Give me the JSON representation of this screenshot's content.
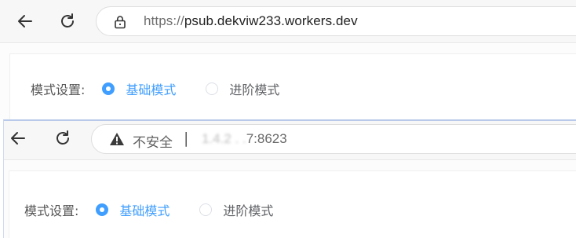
{
  "top_browser": {
    "url_scheme": "https://",
    "url_host": "psub.dekviw233.workers.dev",
    "form": {
      "label": "模式设置:",
      "options": [
        {
          "label": "基础模式",
          "selected": true
        },
        {
          "label": "进阶模式",
          "selected": false
        }
      ]
    }
  },
  "bottom_browser": {
    "security_text": "不安全",
    "separator": "|",
    "url_blurred_part": "1.4.2  .  .",
    "url_visible_part": "7:8623",
    "form": {
      "label": "模式设置:",
      "options": [
        {
          "label": "基础模式",
          "selected": true
        },
        {
          "label": "进阶模式",
          "selected": false
        }
      ]
    }
  },
  "colors": {
    "accent": "#409eff",
    "radio_border": "#dcdfe6",
    "label_text": "#555555",
    "toolbar_bg": "#f7f7f7"
  },
  "icons": {
    "back": "back-arrow-icon",
    "reload": "reload-icon",
    "lock": "lock-icon",
    "warning": "warning-icon"
  }
}
